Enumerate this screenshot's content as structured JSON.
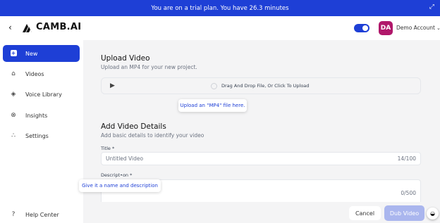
{
  "banner": {
    "text": "You are on a trial plan. You have 26.3 minutes",
    "expand_icon": "expand-arrows-icon"
  },
  "header": {
    "back_icon": "chevron-left-icon",
    "logo_text": "CAMB.AI",
    "avatar_initials": "DA",
    "account_name": "Demo Account",
    "account_chevron": "chevron-down-icon",
    "theme_toggle_on": true
  },
  "sidebar": {
    "items": [
      {
        "label": "New",
        "icon": "plus-square-icon",
        "active": true
      },
      {
        "label": "Videos",
        "icon": "home-icon",
        "active": false
      },
      {
        "label": "Voice Library",
        "icon": "diamond-icon",
        "active": false
      },
      {
        "label": "Insights",
        "icon": "circle-x-icon",
        "active": false
      },
      {
        "label": "Settings",
        "icon": "nodes-icon",
        "active": false
      }
    ],
    "help": {
      "label": "Help Center",
      "icon": "question-icon"
    }
  },
  "upload": {
    "title": "Upload Video",
    "subtitle": "Upload an MP4 for your new project.",
    "dropzone_text": "Drag And Drop File, Or Click To Upload",
    "tooltip": "Upload an \"MP4\" file here."
  },
  "details": {
    "title": "Add Video Details",
    "subtitle": "Add basic details to identify your video",
    "title_label": "Title *",
    "title_value": "Untitled Video",
    "title_count": "14/100",
    "description_label": "Descript•on *",
    "description_count": "0/500",
    "tooltip": "Give it a name and description"
  },
  "actions": {
    "cancel": "Cancel",
    "dub": "Dub Video"
  },
  "colors": {
    "brand": "#1e3fd6",
    "avatar": "#b0176a",
    "dub_disabled": "#aab6ee"
  }
}
